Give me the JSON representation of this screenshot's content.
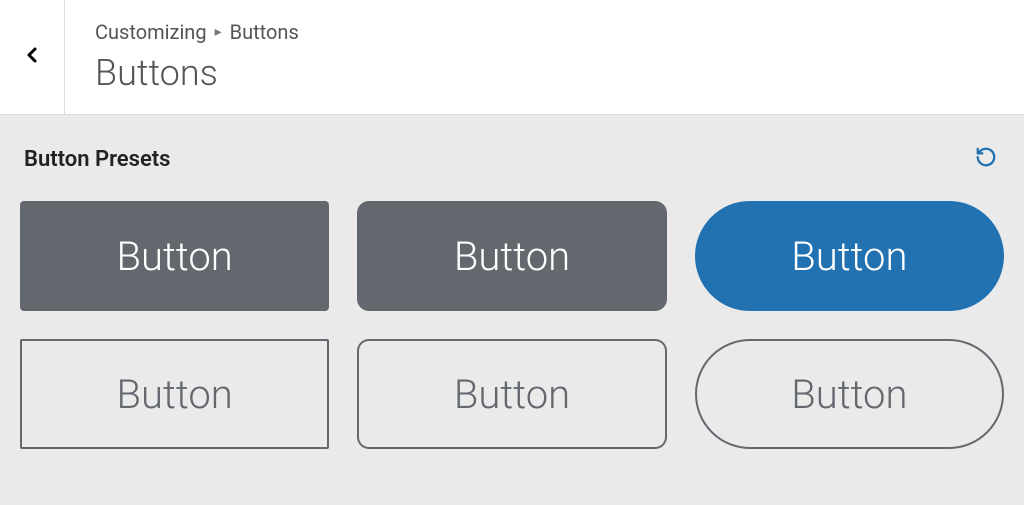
{
  "header": {
    "breadcrumb": {
      "root": "Customizing",
      "current": "Buttons"
    },
    "title": "Buttons"
  },
  "section": {
    "title": "Button Presets"
  },
  "presets": [
    {
      "label": "Button",
      "style": "solid-dark-square",
      "bg": "#63686e",
      "fg": "#ffffff"
    },
    {
      "label": "Button",
      "style": "solid-dark-rounded",
      "bg": "#63686e",
      "fg": "#ffffff"
    },
    {
      "label": "Button",
      "style": "solid-blue-pill",
      "bg": "#2271b1",
      "fg": "#ffffff"
    },
    {
      "label": "Button",
      "style": "outline-square",
      "bg": "transparent",
      "fg": "#63686e"
    },
    {
      "label": "Button",
      "style": "outline-rounded",
      "bg": "transparent",
      "fg": "#63686e"
    },
    {
      "label": "Button",
      "style": "outline-pill",
      "bg": "transparent",
      "fg": "#63686e"
    }
  ]
}
